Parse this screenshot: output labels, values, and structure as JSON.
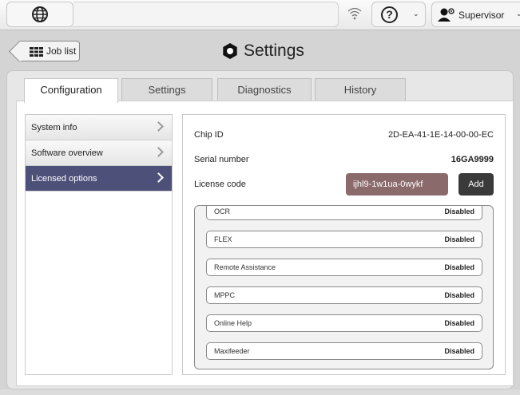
{
  "topbar": {
    "globe_icon": "globe-icon",
    "wifi_icon": "wifi-icon",
    "help_label": "?",
    "user_label": "Supervisor"
  },
  "header": {
    "joblist_label": "Job list",
    "title": "Settings"
  },
  "tabs": [
    {
      "label": "Configuration",
      "active": true
    },
    {
      "label": "Settings",
      "active": false
    },
    {
      "label": "Diagnostics",
      "active": false
    },
    {
      "label": "History",
      "active": false
    }
  ],
  "sidebar": {
    "items": [
      {
        "label": "System info"
      },
      {
        "label": "Software overview"
      },
      {
        "label": "Licensed options",
        "active": true
      }
    ]
  },
  "details": {
    "chip_id_label": "Chip ID",
    "chip_id_value": "2D-EA-41-1E-14-00-00-EC",
    "serial_label": "Serial number",
    "serial_value": "16GA9999",
    "license_label": "License code",
    "license_value": "ijhl9-1w1ua-0wykf",
    "add_label": "Add"
  },
  "options": [
    {
      "name": "OCR",
      "status": "Disabled"
    },
    {
      "name": "FLEX",
      "status": "Disabled"
    },
    {
      "name": "Remote Assistance",
      "status": "Disabled"
    },
    {
      "name": "MPPC",
      "status": "Disabled"
    },
    {
      "name": "Online Help",
      "status": "Disabled"
    },
    {
      "name": "Maxifeeder",
      "status": "Disabled"
    }
  ],
  "colors": {
    "sidebar_active": "#4d5079",
    "license_input": "#8b6a6c",
    "add_button": "#3a3a3a"
  }
}
